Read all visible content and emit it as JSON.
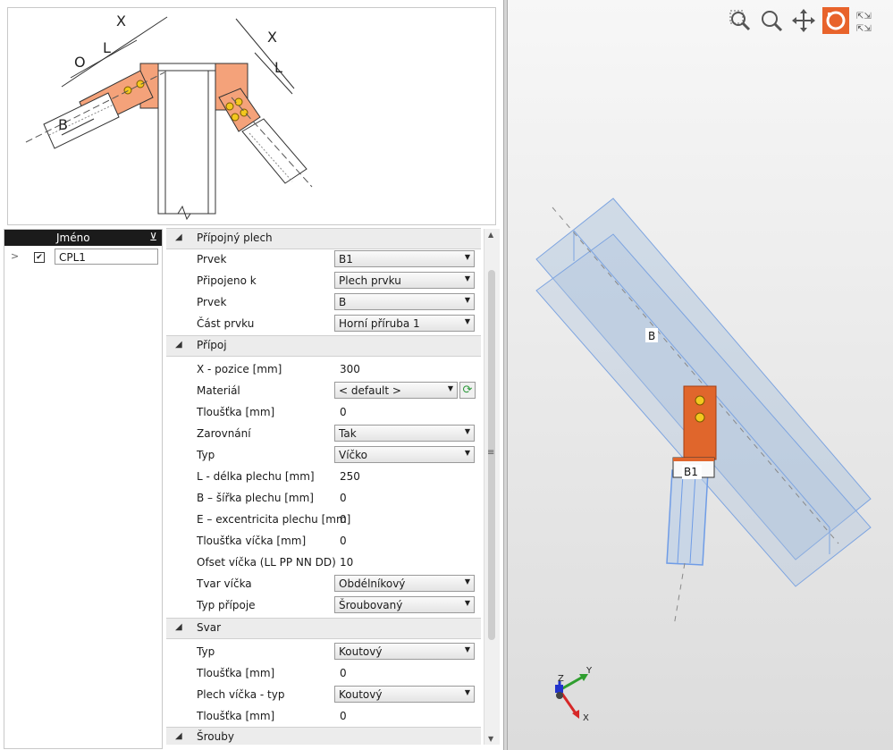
{
  "diagram": {
    "labels": {
      "x_left": "X",
      "l_left": "L",
      "o": "O",
      "b": "B",
      "x_right": "X",
      "l_right": "L"
    }
  },
  "list": {
    "header": "Jméno",
    "rows": [
      {
        "checked": true,
        "name": "CPL1"
      }
    ]
  },
  "properties": {
    "sections": {
      "connected_plate": "Přípojný plech",
      "connection": "Přípoj",
      "weld": "Svar",
      "bolts": "Šrouby"
    },
    "plate": {
      "member_label": "Prvek",
      "member_value": "B1",
      "connected_to_label": "Připojeno k",
      "connected_to_value": "Plech prvku",
      "member2_label": "Prvek",
      "member2_value": "B",
      "member_part_label": "Část prvku",
      "member_part_value": "Horní příruba 1"
    },
    "connection": {
      "x_pos_label": "X - pozice [mm]",
      "x_pos_value": "300",
      "material_label": "Materiál",
      "material_value": "< default >",
      "thickness_label": "Tloušťka [mm]",
      "thickness_value": "0",
      "alignment_label": "Zarovnání",
      "alignment_value": "Tak",
      "type_label": "Typ",
      "type_value": "Víčko",
      "plate_length_label": "L - délka plechu [mm]",
      "plate_length_value": "250",
      "plate_width_label": "B – šířka plechu [mm]",
      "plate_width_value": "0",
      "eccentricity_label": "E – excentricita plechu [mm]",
      "eccentricity_value": "0",
      "cap_thickness_label": "Tloušťka víčka [mm]",
      "cap_thickness_value": "0",
      "cap_offset_label": "Ofset víčka (LL PP NN DD)",
      "cap_offset_value": "10",
      "cap_shape_label": "Tvar víčka",
      "cap_shape_value": "Obdélníkový",
      "joint_type_label": "Typ přípoje",
      "joint_type_value": "Šroubovaný"
    },
    "weld": {
      "type_label": "Typ",
      "type_value": "Koutový",
      "thickness_label": "Tloušťka [mm]",
      "thickness_value": "0",
      "cap_plate_type_label": "Plech víčka - typ",
      "cap_plate_type_value": "Koutový",
      "thickness2_label": "Tloušťka [mm]",
      "thickness2_value": "0"
    }
  },
  "viewport": {
    "member_labels": {
      "beam": "B",
      "column": "B1"
    },
    "axes": {
      "x": "X",
      "y": "Y",
      "z": "Z"
    },
    "accent_color": "#e8632b",
    "tools": [
      "zoom-window-icon",
      "zoom-icon",
      "pan-icon",
      "rotate-icon",
      "fit-view-icon"
    ]
  }
}
